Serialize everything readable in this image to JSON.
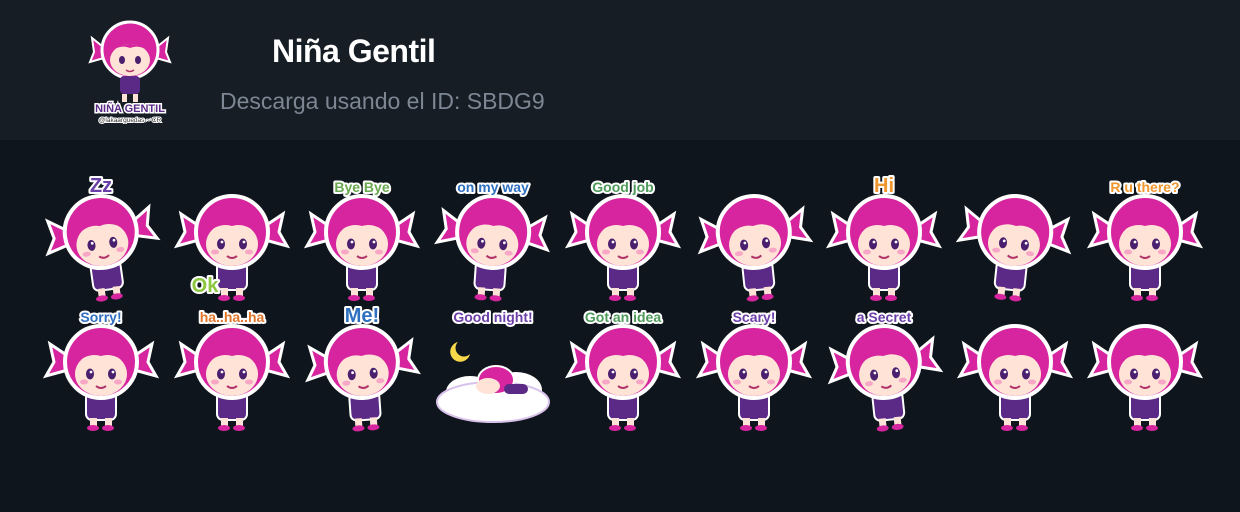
{
  "pack": {
    "title": "Niña Gentil",
    "subtitle": "Descarga usando el ID: SBDG9",
    "logo_line1": "NIÑA GENTIL",
    "logo_line2": "@lakaarguedas ~ CR"
  },
  "colors": {
    "header_bg": "#161d25",
    "page_bg": "#0f151c",
    "hair": "#d6259f",
    "dress": "#5a2a86",
    "accent": "#7b3fb0"
  },
  "stickers": [
    {
      "caption": "Zz",
      "caption_color": "#6b3fa8"
    },
    {
      "caption": "Ok",
      "caption_color": "#8cc63f"
    },
    {
      "caption": "Bye Bye",
      "caption_color": "#6aa84f"
    },
    {
      "caption": "on my way",
      "caption_color": "#2f6fbf"
    },
    {
      "caption": "Good job",
      "caption_color": "#4e9a5a"
    },
    {
      "caption": "",
      "caption_color": "#6b3fa8"
    },
    {
      "caption": "Hi",
      "caption_color": "#f0962e"
    },
    {
      "caption": "",
      "caption_color": "#6b3fa8"
    },
    {
      "caption": "R u there?",
      "caption_color": "#f0962e"
    },
    {
      "caption": "Sorry!",
      "caption_color": "#2f6fbf"
    },
    {
      "caption": "ha..ha..ha",
      "caption_color": "#e0762a"
    },
    {
      "caption": "Me!",
      "caption_color": "#2f6fbf"
    },
    {
      "caption": "Good night!",
      "caption_color": "#6b3fa8"
    },
    {
      "caption": "Got an idea",
      "caption_color": "#4e9a5a"
    },
    {
      "caption": "Scary!",
      "caption_color": "#6b3fa8"
    },
    {
      "caption": "a Secret",
      "caption_color": "#6b3fa8"
    },
    {
      "caption": "",
      "caption_color": "#6b3fa8"
    },
    {
      "caption": "",
      "caption_color": "#6b3fa8"
    }
  ]
}
